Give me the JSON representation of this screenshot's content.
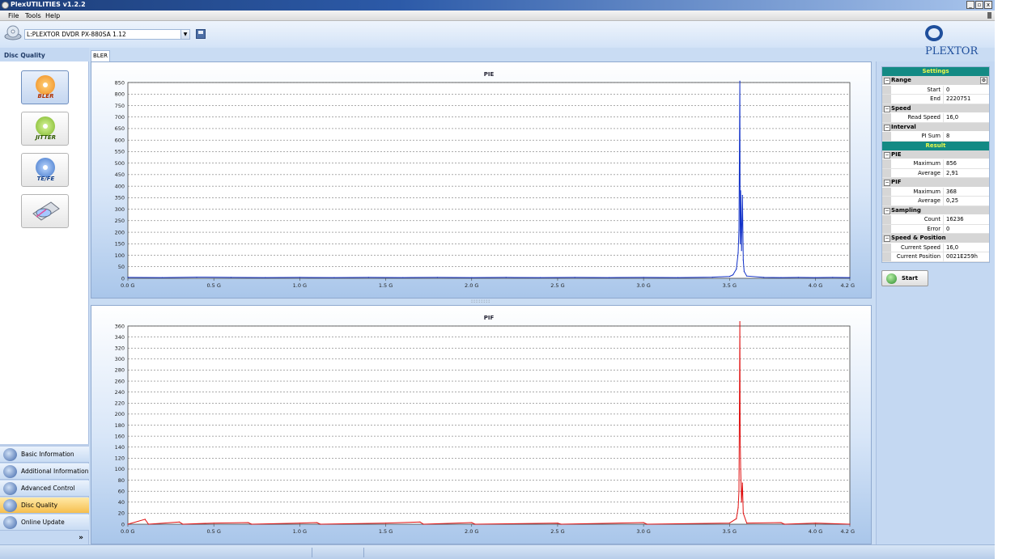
{
  "window": {
    "title": "PlexUTILITIES v1.2.2",
    "buttons": [
      "_",
      "▫",
      "x"
    ]
  },
  "menu": [
    "File",
    "Tools",
    "Help"
  ],
  "toolbar": {
    "drive": "L:PLEXTOR DVDR   PX-880SA  1.12",
    "brand": "PLEXTOR"
  },
  "left_panel": {
    "header": "Disc Quality",
    "modes": [
      {
        "label": "BLER",
        "active": true
      },
      {
        "label": "JITTER",
        "active": false
      },
      {
        "label": "TE/FE",
        "active": false
      },
      {
        "label": "",
        "active": false
      }
    ]
  },
  "nav": [
    {
      "label": "Basic Information",
      "icon": "info-disc-icon"
    },
    {
      "label": "Additional Information",
      "icon": "additional-info-icon"
    },
    {
      "label": "Advanced Control",
      "icon": "advanced-control-icon"
    },
    {
      "label": "Disc Quality",
      "icon": "disc-quality-icon",
      "active": true
    },
    {
      "label": "Online Update",
      "icon": "online-update-icon"
    }
  ],
  "tab": "BLER",
  "settings": {
    "title": "Settings",
    "range": {
      "label": "Range",
      "start_label": "Start",
      "start": "0",
      "end_label": "End",
      "end": "2220751"
    },
    "speed": {
      "label": "Speed",
      "read_speed_label": "Read Speed",
      "read_speed": "16,0"
    },
    "interval": {
      "label": "Interval",
      "pi_sum_label": "PI Sum",
      "pi_sum": "8"
    }
  },
  "result": {
    "title": "Result",
    "pie": {
      "label": "PIE",
      "max_label": "Maximum",
      "max": "856",
      "avg_label": "Average",
      "avg": "2,91"
    },
    "pif": {
      "label": "PIF",
      "max_label": "Maximum",
      "max": "368",
      "avg_label": "Average",
      "avg": "0,25"
    },
    "sampling": {
      "label": "Sampling",
      "count_label": "Count",
      "count": "16236",
      "error_label": "Error",
      "error": "0"
    },
    "speed_position": {
      "label": "Speed & Position",
      "current_speed_label": "Current Speed",
      "current_speed": "16,0",
      "current_position_label": "Current Position",
      "current_position": "0021E259h"
    }
  },
  "start_button": "Start",
  "colors": {
    "pie_line": "#1030c8",
    "pif_line": "#e01010",
    "settings_header": "#138a84",
    "settings_header_text": "#e8f84a"
  },
  "chart_data": [
    {
      "type": "line",
      "title": "PIE",
      "xlim": [
        0,
        4.2
      ],
      "ylim": [
        0,
        850
      ],
      "x_ticks": [
        "0.0 G",
        "0.5 G",
        "1.0 G",
        "1.5 G",
        "2.0 G",
        "2.5 G",
        "3.0 G",
        "3.5 G",
        "4.0 G",
        "4.2 G"
      ],
      "y_ticks": [
        0,
        50,
        100,
        150,
        200,
        250,
        300,
        350,
        400,
        450,
        500,
        550,
        600,
        650,
        700,
        750,
        800,
        850
      ],
      "grid": true,
      "series": [
        {
          "color": "#1030c8",
          "points": [
            [
              0.0,
              4
            ],
            [
              0.2,
              3
            ],
            [
              0.4,
              5
            ],
            [
              0.6,
              4
            ],
            [
              0.8,
              3
            ],
            [
              1.0,
              4
            ],
            [
              1.2,
              3
            ],
            [
              1.4,
              4
            ],
            [
              1.6,
              3
            ],
            [
              1.8,
              4
            ],
            [
              2.0,
              3
            ],
            [
              2.2,
              4
            ],
            [
              2.4,
              3
            ],
            [
              2.6,
              4
            ],
            [
              2.8,
              3
            ],
            [
              3.0,
              4
            ],
            [
              3.2,
              3
            ],
            [
              3.4,
              5
            ],
            [
              3.5,
              8
            ],
            [
              3.52,
              15
            ],
            [
              3.54,
              40
            ],
            [
              3.55,
              110
            ],
            [
              3.555,
              210
            ],
            [
              3.56,
              856
            ],
            [
              3.562,
              150
            ],
            [
              3.565,
              380
            ],
            [
              3.57,
              120
            ],
            [
              3.575,
              360
            ],
            [
              3.58,
              80
            ],
            [
              3.585,
              30
            ],
            [
              3.6,
              10
            ],
            [
              3.7,
              4
            ],
            [
              3.8,
              3
            ],
            [
              3.9,
              4
            ],
            [
              4.0,
              3
            ],
            [
              4.1,
              4
            ],
            [
              4.2,
              3
            ]
          ]
        }
      ]
    },
    {
      "type": "line",
      "title": "PIF",
      "xlim": [
        0,
        4.2
      ],
      "ylim": [
        0,
        360
      ],
      "x_ticks": [
        "0.0 G",
        "0.5 G",
        "1.0 G",
        "1.5 G",
        "2.0 G",
        "2.5 G",
        "3.0 G",
        "3.5 G",
        "4.0 G",
        "4.2 G"
      ],
      "y_ticks": [
        0,
        20,
        40,
        60,
        80,
        100,
        120,
        140,
        160,
        180,
        200,
        220,
        240,
        260,
        280,
        300,
        320,
        340,
        360
      ],
      "grid": true,
      "series": [
        {
          "color": "#e01010",
          "points": [
            [
              0.0,
              0
            ],
            [
              0.1,
              9
            ],
            [
              0.12,
              0
            ],
            [
              0.3,
              4
            ],
            [
              0.32,
              0
            ],
            [
              0.5,
              2
            ],
            [
              0.7,
              3
            ],
            [
              0.72,
              0
            ],
            [
              1.0,
              2
            ],
            [
              1.1,
              3
            ],
            [
              1.12,
              0
            ],
            [
              1.5,
              2
            ],
            [
              1.7,
              4
            ],
            [
              1.72,
              0
            ],
            [
              2.0,
              3
            ],
            [
              2.02,
              0
            ],
            [
              2.5,
              2
            ],
            [
              2.52,
              0
            ],
            [
              3.0,
              3
            ],
            [
              3.02,
              0
            ],
            [
              3.5,
              2
            ],
            [
              3.54,
              10
            ],
            [
              3.55,
              30
            ],
            [
              3.555,
              60
            ],
            [
              3.56,
              368
            ],
            [
              3.562,
              160
            ],
            [
              3.565,
              100
            ],
            [
              3.57,
              40
            ],
            [
              3.575,
              75
            ],
            [
              3.58,
              20
            ],
            [
              3.6,
              2
            ],
            [
              3.8,
              3
            ],
            [
              3.82,
              0
            ],
            [
              4.0,
              2
            ],
            [
              4.2,
              0
            ]
          ]
        }
      ]
    }
  ]
}
